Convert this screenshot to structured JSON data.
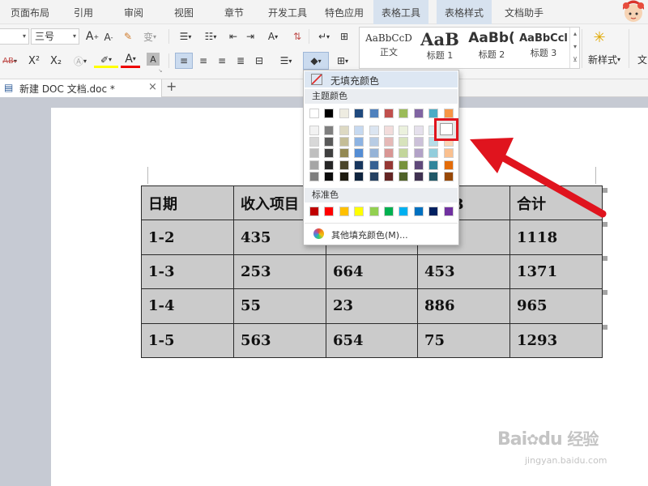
{
  "menubar": {
    "items": [
      "页面布局",
      "引用",
      "审阅",
      "视图",
      "章节",
      "开发工具",
      "特色应用",
      "表格工具",
      "表格样式",
      "文档助手"
    ]
  },
  "toolbar": {
    "font_size": "三号",
    "increase_font": "A",
    "decrease_font": "A",
    "pinyin": "变",
    "superscript": "X²",
    "subscript": "X₂",
    "font_color_letter": "A",
    "char_shading": "A",
    "style_gallery": [
      {
        "sample": "AaBbCcD",
        "label": "正文"
      },
      {
        "sample": "AaB",
        "label": "标题 1"
      },
      {
        "sample": "AaBb(",
        "label": "标题 2"
      },
      {
        "sample": "AaBbCcl",
        "label": "标题 3"
      }
    ],
    "new_style": "新样式",
    "cut_label": "文"
  },
  "tabbar": {
    "doc_title": "新建 DOC 文档.doc *",
    "close": "×",
    "new_tab": "+"
  },
  "table": {
    "rows": [
      [
        "日期",
        "收入项目",
        "",
        "项目3",
        "合计"
      ],
      [
        "1-2",
        "435",
        "",
        "",
        "1118"
      ],
      [
        "1-3",
        "253",
        "664",
        "453",
        "1371"
      ],
      [
        "1-4",
        "55",
        "23",
        "886",
        "965"
      ],
      [
        "1-5",
        "563",
        "654",
        "75",
        "1293"
      ]
    ]
  },
  "fill_popup": {
    "no_fill": "无填充颜色",
    "theme_title": "主题颜色",
    "theme_top": [
      "#ffffff",
      "#000000",
      "#eeece1",
      "#1f497d",
      "#4f81bd",
      "#c0504d",
      "#9bbb59",
      "#8064a2",
      "#4bacc6",
      "#f79646"
    ],
    "theme_shades": [
      [
        "#f2f2f2",
        "#7f7f7f",
        "#ddd9c3",
        "#c6d9f0",
        "#dbe5f1",
        "#f2dcdb",
        "#ebf1dd",
        "#e5e0ec",
        "#dbeef3",
        "#fdeada"
      ],
      [
        "#d8d8d8",
        "#595959",
        "#c4bd97",
        "#8db3e2",
        "#b8cce4",
        "#e5b9b7",
        "#d7e3bc",
        "#ccc1d9",
        "#b7dde8",
        "#fbd5b5"
      ],
      [
        "#bfbfbf",
        "#3f3f3f",
        "#938953",
        "#548dd4",
        "#95b3d7",
        "#d99694",
        "#c3d69b",
        "#b2a2c7",
        "#92cddc",
        "#fac08f"
      ],
      [
        "#a5a5a5",
        "#262626",
        "#494429",
        "#17365d",
        "#366092",
        "#953734",
        "#76923c",
        "#5f497a",
        "#31859b",
        "#e36c09"
      ],
      [
        "#7f7f7f",
        "#0c0c0c",
        "#1d1b10",
        "#0f243e",
        "#244061",
        "#632423",
        "#4f6128",
        "#3f3151",
        "#205867",
        "#974806"
      ]
    ],
    "standard_title": "标准色",
    "standard": [
      "#c00000",
      "#ff0000",
      "#ffc000",
      "#ffff00",
      "#92d050",
      "#00b050",
      "#00b0f0",
      "#0070c0",
      "#002060",
      "#7030a0"
    ],
    "more_colors": "其他填充颜色(M)..."
  },
  "colors": {
    "accent_red": "#e0141e",
    "tab_active": "#d7e2ef",
    "table_fill": "#cbcbcb"
  },
  "watermark": {
    "brand": "Bai",
    "brand2": "du",
    "cn": "经验",
    "url": "jingyan.baidu.com"
  }
}
